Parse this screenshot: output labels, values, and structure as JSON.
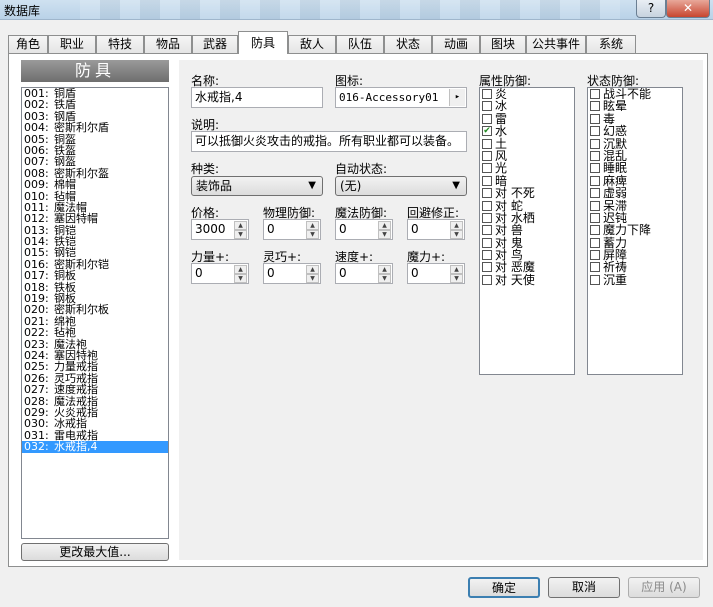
{
  "window": {
    "title": "数据库",
    "help_label": "?",
    "close_label": "✕"
  },
  "tabs": [
    "角色",
    "职业",
    "特技",
    "物品",
    "武器",
    "防具",
    "敌人",
    "队伍",
    "状态",
    "动画",
    "图块",
    "公共事件",
    "系统"
  ],
  "active_tab": "防具",
  "list": {
    "header": "防具",
    "items": [
      {
        "num": "001:",
        "name": "铜盾"
      },
      {
        "num": "002:",
        "name": "铁盾"
      },
      {
        "num": "003:",
        "name": "钢盾"
      },
      {
        "num": "004:",
        "name": "密斯利尔盾"
      },
      {
        "num": "005:",
        "name": "铜盔"
      },
      {
        "num": "006:",
        "name": "铁盔"
      },
      {
        "num": "007:",
        "name": "钢盔"
      },
      {
        "num": "008:",
        "name": "密斯利尔盔"
      },
      {
        "num": "009:",
        "name": "棉帽"
      },
      {
        "num": "010:",
        "name": "毡帽"
      },
      {
        "num": "011:",
        "name": "魔法帽"
      },
      {
        "num": "012:",
        "name": "塞因特帽"
      },
      {
        "num": "013:",
        "name": "铜铠"
      },
      {
        "num": "014:",
        "name": "铁铠"
      },
      {
        "num": "015:",
        "name": "钢铠"
      },
      {
        "num": "016:",
        "name": "密斯利尔铠"
      },
      {
        "num": "017:",
        "name": "铜板"
      },
      {
        "num": "018:",
        "name": "铁板"
      },
      {
        "num": "019:",
        "name": "钢板"
      },
      {
        "num": "020:",
        "name": "密斯利尔板"
      },
      {
        "num": "021:",
        "name": "绵袍"
      },
      {
        "num": "022:",
        "name": "毡袍"
      },
      {
        "num": "023:",
        "name": "魔法袍"
      },
      {
        "num": "024:",
        "name": "塞因特袍"
      },
      {
        "num": "025:",
        "name": "力量戒指"
      },
      {
        "num": "026:",
        "name": "灵巧戒指"
      },
      {
        "num": "027:",
        "name": "速度戒指"
      },
      {
        "num": "028:",
        "name": "魔法戒指"
      },
      {
        "num": "029:",
        "name": "火炎戒指"
      },
      {
        "num": "030:",
        "name": "冰戒指"
      },
      {
        "num": "031:",
        "name": "雷电戒指"
      },
      {
        "num": "032:",
        "name": "水戒指,4"
      }
    ],
    "selected_index": 31,
    "change_max_label": "更改最大值..."
  },
  "editor": {
    "name_label": "名称:",
    "name_value": "水戒指,4",
    "icon_label": "图标:",
    "icon_value": "016-Accessory01",
    "icon_button": "▸",
    "desc_label": "说明:",
    "desc_value": "可以抵御火炎攻击的戒指。所有职业都可以装备。",
    "kind_label": "种类:",
    "kind_value": "装饰品",
    "auto_state_label": "自动状态:",
    "auto_state_value": "(无)",
    "row1": [
      {
        "label": "价格:",
        "value": "3000"
      },
      {
        "label": "物理防御:",
        "value": "0"
      },
      {
        "label": "魔法防御:",
        "value": "0"
      },
      {
        "label": "回避修正:",
        "value": "0"
      }
    ],
    "row2": [
      {
        "label": "力量+:",
        "value": "0"
      },
      {
        "label": "灵巧+:",
        "value": "0"
      },
      {
        "label": "速度+:",
        "value": "0"
      },
      {
        "label": "魔力+:",
        "value": "0"
      }
    ],
    "element_label": "属性防御:",
    "elements": [
      {
        "text": "炎",
        "checked": false
      },
      {
        "text": "冰",
        "checked": false
      },
      {
        "text": "雷",
        "checked": false
      },
      {
        "text": "水",
        "checked": true
      },
      {
        "text": "土",
        "checked": false
      },
      {
        "text": "风",
        "checked": false
      },
      {
        "text": "光",
        "checked": false
      },
      {
        "text": "暗",
        "checked": false
      },
      {
        "text": "对  不死",
        "checked": false
      },
      {
        "text": "对 蛇",
        "checked": false
      },
      {
        "text": "对 水栖",
        "checked": false
      },
      {
        "text": "对 兽",
        "checked": false
      },
      {
        "text": "对 鬼",
        "checked": false
      },
      {
        "text": "对 鸟",
        "checked": false
      },
      {
        "text": "对 恶魔",
        "checked": false
      },
      {
        "text": "对 天使",
        "checked": false
      }
    ],
    "state_label": "状态防御:",
    "states": [
      {
        "text": "战斗不能",
        "checked": false
      },
      {
        "text": "眩晕",
        "checked": false
      },
      {
        "text": "毒",
        "checked": false
      },
      {
        "text": "幻惑",
        "checked": false
      },
      {
        "text": "沉默",
        "checked": false
      },
      {
        "text": "混乱",
        "checked": false
      },
      {
        "text": "睡眠",
        "checked": false
      },
      {
        "text": "麻痺",
        "checked": false
      },
      {
        "text": "虚弱",
        "checked": false
      },
      {
        "text": "呆滞",
        "checked": false
      },
      {
        "text": "迟钝",
        "checked": false
      },
      {
        "text": "魔力下降",
        "checked": false
      },
      {
        "text": "蓄力",
        "checked": false
      },
      {
        "text": "屏障",
        "checked": false
      },
      {
        "text": "祈祷",
        "checked": false
      },
      {
        "text": "沉重",
        "checked": false
      }
    ]
  },
  "footer": {
    "ok_label": "确定",
    "cancel_label": "取消",
    "apply_label": "应用 (A)"
  }
}
